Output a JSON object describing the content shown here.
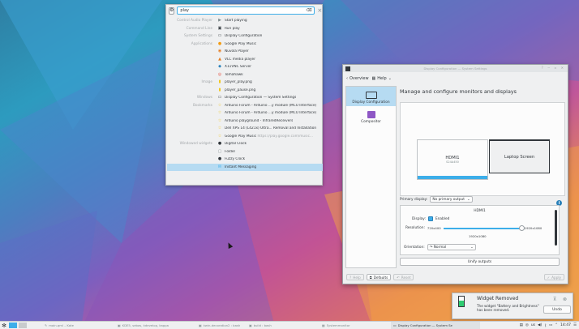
{
  "krunner": {
    "query": "play",
    "config_icon": "gear-icon",
    "clear_icon": "backspace-icon",
    "close_icon": "close-icon",
    "results": [
      {
        "category": "Control Audio Player",
        "icon": "play-icon",
        "text": "Start playing",
        "dim": ""
      },
      {
        "category": "Command Line",
        "icon": "terminal-icon",
        "text": "Run play",
        "dim": ""
      },
      {
        "category": "System Settings",
        "icon": "monitor-icon",
        "text": "Display Configuration",
        "dim": ""
      },
      {
        "category": "Applications",
        "icon": "headphones-icon",
        "text": "Google Play Music",
        "dim": ""
      },
      {
        "category": "",
        "icon": "player-icon",
        "text": "Nuvola Player",
        "dim": ""
      },
      {
        "category": "",
        "icon": "vlc-icon",
        "text": "VLC media player",
        "dim": ""
      },
      {
        "category": "",
        "icon": "vnc-icon",
        "text": "X11VNC Server",
        "dim": ""
      },
      {
        "category": "",
        "icon": "tomahawk-icon",
        "text": "Tomahawk",
        "dim": ""
      },
      {
        "category": "Image",
        "icon": "image-file-icon",
        "text": "player_play.png",
        "dim": ""
      },
      {
        "category": "",
        "icon": "image-file-icon",
        "text": "player_pause.png",
        "dim": ""
      },
      {
        "category": "Windows",
        "icon": "monitor-icon",
        "text": "Display Configuration — System Settings",
        "dim": ""
      },
      {
        "category": "Bookmarks",
        "icon": "bookmark-icon",
        "text": "Arduino Forum - Arduino ...y module (MCU Interface)",
        "dim": ""
      },
      {
        "category": "",
        "icon": "bookmark-icon",
        "text": "Arduino Forum - Arduino ...y module (MCU Interface)",
        "dim": ""
      },
      {
        "category": "",
        "icon": "bookmark-icon",
        "text": "Arduino playground - InfraredReceivers",
        "dim": ""
      },
      {
        "category": "",
        "icon": "bookmark-icon",
        "text": "Dell XPS 14 (L421x) Ultra... Removal and Installation",
        "dim": ""
      },
      {
        "category": "",
        "icon": "bookmark-icon",
        "text": "Google Play Music ",
        "dim": "https://play.google.com/music..."
      },
      {
        "category": "Windowed widgets",
        "icon": "clock-icon",
        "text": "Digital Clock",
        "dim": ""
      },
      {
        "category": "",
        "icon": "folder-icon",
        "text": "Folder",
        "dim": ""
      },
      {
        "category": "",
        "icon": "clock-icon",
        "text": "Fuzzy Clock",
        "dim": ""
      },
      {
        "category": "",
        "icon": "chat-icon",
        "text": "Instant Messaging",
        "dim": ""
      }
    ]
  },
  "window": {
    "title": "Display Configuration — System Settings",
    "toolbar": {
      "overview": "Overview",
      "help": "Help"
    },
    "sidebar": [
      {
        "label": "Display Configuration",
        "icon": "monitor-icon",
        "selected": true
      },
      {
        "label": "Compositor",
        "icon": "compositor-icon",
        "selected": false
      }
    ],
    "heading": "Manage and configure monitors and displays",
    "monitors": [
      {
        "name": "HDMI1",
        "model": "S24A450"
      },
      {
        "name": "Laptop Screen",
        "model": ""
      }
    ],
    "primary_label": "Primary display:",
    "primary_value": "No primary output",
    "output": {
      "name": "HDMI1",
      "display_label": "Display:",
      "enabled_label": "Enabled",
      "enabled": true,
      "resolution_label": "Resolution:",
      "res_min": "720x400",
      "res_max": "1920x1080",
      "res_current": "1920x1080",
      "slider_fraction": 1.0,
      "orientation_label": "Orientation:",
      "orientation_value": "Normal"
    },
    "unify_label": "Unify outputs",
    "buttons": {
      "help": "Help",
      "defaults": "Defaults",
      "reset": "Reset",
      "apply": "Apply"
    }
  },
  "notification": {
    "title": "Widget Removed",
    "body": "The widget \"Battery and Brightness\" has been removed.",
    "undo": "Undo"
  },
  "taskbar": {
    "tasks": [
      {
        "text": "main.qml – Kate",
        "active": false
      },
      {
        "text": "KDE5, sebas, kdevelop, kappa",
        "active": false
      },
      {
        "text": "kwin-decoration2 : bash",
        "active": false
      },
      {
        "text": "build : bash",
        "active": false
      },
      {
        "text": "Systemmonitor",
        "active": false
      },
      {
        "text": "Display Configuration — System Se",
        "active": true
      }
    ],
    "keyboard_layout": "us",
    "clock": "14:47"
  },
  "colors": {
    "accent": "#3daee9",
    "selection": "#b6dbf2",
    "text": "#31363b",
    "dim": "#a4a8ab"
  }
}
